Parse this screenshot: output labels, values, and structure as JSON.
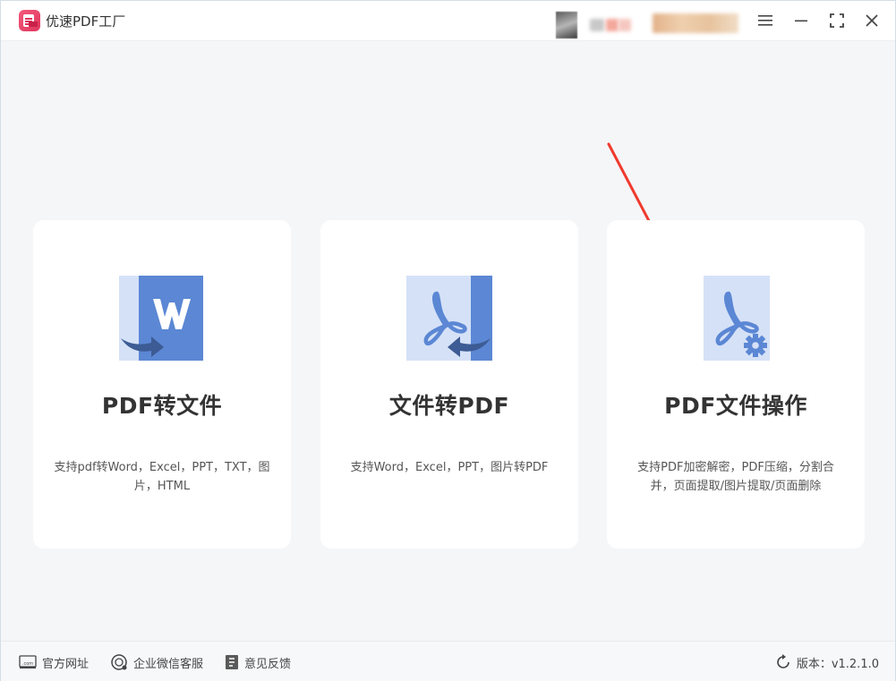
{
  "app": {
    "title": "优速PDF工厂",
    "brand_color": "#e0345c"
  },
  "window_controls": {
    "menu_icon": "menu-icon",
    "minimize_icon": "minimize-icon",
    "fullscreen_icon": "fullscreen-icon",
    "close_icon": "close-icon"
  },
  "cards": [
    {
      "title": "PDF转文件",
      "description": "支持pdf转Word，Excel，PPT，TXT，图片，HTML",
      "icon": "pdf-to-word-icon"
    },
    {
      "title": "文件转PDF",
      "description": "支持Word，Excel，PPT，图片转PDF",
      "icon": "file-to-pdf-icon"
    },
    {
      "title": "PDF文件操作",
      "description": "支持PDF加密解密，PDF压缩，分割合并，页面提取/图片提取/页面删除",
      "icon": "pdf-settings-icon"
    }
  ],
  "footer": {
    "website": "官方网址",
    "wechat_service": "企业微信客服",
    "feedback": "意见反馈",
    "version": "版本：v1.2.1.0"
  },
  "colors": {
    "icon_blue": "#5b87d4",
    "icon_light": "#d5e1f7",
    "arrow_dark": "#3d5b94",
    "annotation_red": "#f03a2e"
  }
}
